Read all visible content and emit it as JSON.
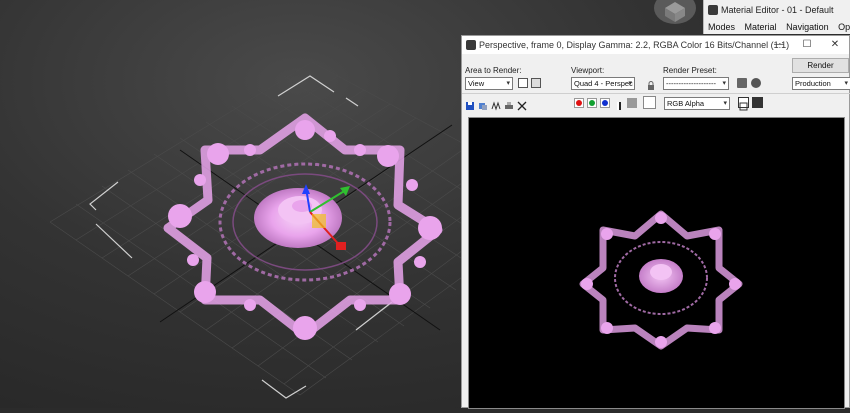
{
  "material_editor": {
    "title": "Material Editor - 01 - Default",
    "menu": [
      "Modes",
      "Material",
      "Navigation",
      "Options"
    ]
  },
  "render_window": {
    "title": "Perspective, frame 0, Display Gamma: 2.2, RGBA Color 16 Bits/Channel (1:1)",
    "window_controls": [
      "—",
      "☐",
      "✕"
    ],
    "area_to_render_label": "Area to Render:",
    "area_to_render_value": "View",
    "viewport_label": "Viewport:",
    "viewport_value": "Quad 4 - Perspec",
    "render_preset_label": "Render Preset:",
    "render_preset_value": "--------------------",
    "render_button": "Render",
    "production_value": "Production",
    "channel_value": "RGB Alpha"
  },
  "colors": {
    "rose_pink": "#e9a4ec",
    "viewport_bg": "#333333",
    "render_bg": "#000000",
    "red_channel": "#e01010",
    "green_channel": "#10a030",
    "blue_channel": "#1030d0"
  },
  "icons": [
    "app-icon",
    "save-image-icon",
    "copy-image-icon",
    "lock-icon",
    "render-setup-icon",
    "teapot-icon",
    "red-channel",
    "green-channel",
    "blue-channel",
    "alpha-toggle",
    "mono-toggle",
    "display-toggle"
  ]
}
